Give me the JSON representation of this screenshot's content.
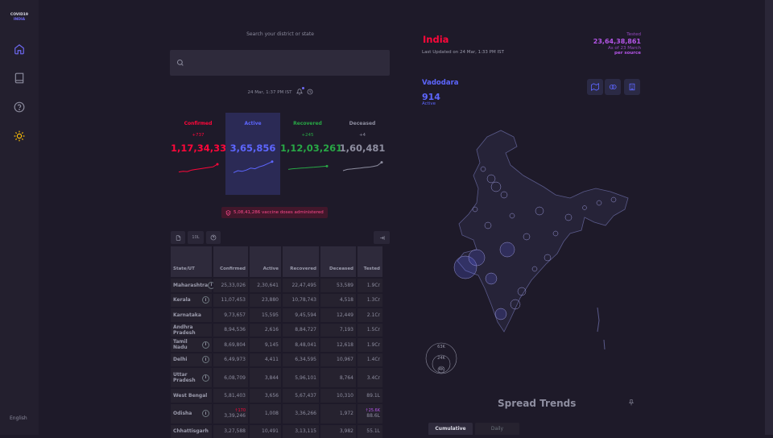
{
  "brand": {
    "line1": "COVID19",
    "line2": "INDIA"
  },
  "sidebar": {
    "icons": [
      "home-icon",
      "book-icon",
      "help-icon",
      "sun-icon"
    ],
    "language": "English"
  },
  "search": {
    "label": "Search your district or state",
    "placeholder": ""
  },
  "timestamp": "24 Mar, 1:37 PM IST",
  "levels": [
    {
      "key": "confirmed",
      "title": "Confirmed",
      "delta": "+737",
      "total": "1,17,34,331",
      "color": "#ff073a",
      "trend": [
        0.15,
        0.2,
        0.18,
        0.3,
        0.35,
        0.4,
        0.45,
        0.5,
        0.55,
        0.75
      ]
    },
    {
      "key": "active",
      "title": "Active",
      "delta": "",
      "total": "3,65,856",
      "color": "#5d66ff",
      "trend": [
        0.1,
        0.25,
        0.2,
        0.3,
        0.45,
        0.4,
        0.55,
        0.65,
        0.8,
        0.95
      ]
    },
    {
      "key": "recovered",
      "title": "Recovered",
      "delta": "+245",
      "total": "1,12,03,261",
      "color": "#28a745",
      "trend": [
        0.35,
        0.4,
        0.42,
        0.45,
        0.47,
        0.5,
        0.52,
        0.55,
        0.58,
        0.6
      ]
    },
    {
      "key": "deceased",
      "title": "Deceased",
      "delta": "+4",
      "total": "1,60,481",
      "color": "#8e8ea0",
      "trend": [
        0.25,
        0.35,
        0.38,
        0.42,
        0.45,
        0.5,
        0.52,
        0.58,
        0.65,
        0.9
      ]
    }
  ],
  "vaccine": {
    "text": "5,08,41,286 vaccine doses administered"
  },
  "table_toolbar": {
    "per_10l": "10L"
  },
  "table": {
    "columns": [
      "State/UT",
      "Confirmed",
      "Active",
      "Recovered",
      "Deceased",
      "Tested"
    ],
    "rows": [
      {
        "state": "Maharashtra",
        "info": true,
        "confirmed": "25,33,026",
        "active": "2,30,641",
        "recovered": "22,47,495",
        "deceased": "53,589",
        "tested": "1.9Cr"
      },
      {
        "state": "Kerala",
        "info": true,
        "confirmed": "11,07,453",
        "active": "23,880",
        "recovered": "10,78,743",
        "deceased": "4,518",
        "tested": "1.3Cr"
      },
      {
        "state": "Karnataka",
        "info": false,
        "confirmed": "9,73,657",
        "active": "15,595",
        "recovered": "9,45,594",
        "deceased": "12,449",
        "tested": "2.1Cr"
      },
      {
        "state": "Andhra Pradesh",
        "info": false,
        "confirmed": "8,94,536",
        "active": "2,616",
        "recovered": "8,84,727",
        "deceased": "7,193",
        "tested": "1.5Cr"
      },
      {
        "state": "Tamil Nadu",
        "info": true,
        "confirmed": "8,69,804",
        "active": "9,145",
        "recovered": "8,48,041",
        "deceased": "12,618",
        "tested": "1.9Cr"
      },
      {
        "state": "Delhi",
        "info": true,
        "confirmed": "6,49,973",
        "active": "4,411",
        "recovered": "6,34,595",
        "deceased": "10,967",
        "tested": "1.4Cr"
      },
      {
        "state": "Uttar Pradesh",
        "info": true,
        "confirmed": "6,08,709",
        "active": "3,844",
        "recovered": "5,96,101",
        "deceased": "8,764",
        "tested": "3.4Cr"
      },
      {
        "state": "West Bengal",
        "info": false,
        "confirmed": "5,81,403",
        "active": "3,656",
        "recovered": "5,67,437",
        "deceased": "10,310",
        "tested": "89.1L"
      },
      {
        "state": "Odisha",
        "info": true,
        "confirmed": "3,39,246",
        "confirmed_delta": "↑170",
        "active": "1,008",
        "recovered": "3,36,266",
        "deceased": "1,972",
        "tested": "88.6L",
        "tested_delta": "↑25.6K"
      },
      {
        "state": "Chhattisgarh",
        "info": false,
        "confirmed": "3,27,588",
        "active": "10,491",
        "recovered": "3,13,115",
        "deceased": "3,982",
        "tested": "55.1L"
      }
    ]
  },
  "map_panel": {
    "country": "India",
    "last_updated": "Last Updated on 24 Mar, 1:33 PM IST",
    "tested_label": "Tested",
    "tested_value": "23,64,38,861",
    "tested_asof": "As of 23 March",
    "tested_source": "per source",
    "region": "Vadodara",
    "region_count": "914",
    "region_metric": "Active",
    "legend": [
      "63K",
      "24K",
      "4K"
    ]
  },
  "spread": {
    "title": "Spread Trends",
    "tabs": [
      "Cumulative",
      "Daily"
    ]
  }
}
